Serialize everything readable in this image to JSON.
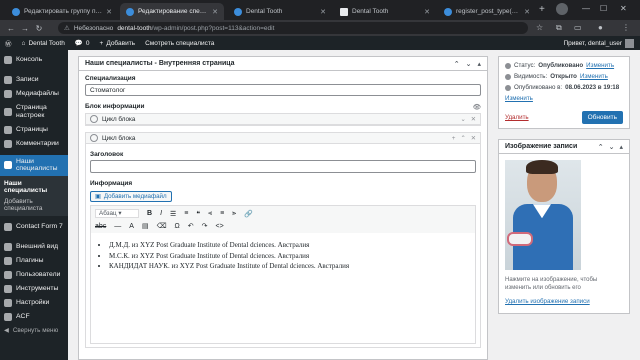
{
  "browser": {
    "tabs": [
      {
        "title": "Редактировать группу полей \"Н",
        "icon": "wordpress-icon"
      },
      {
        "title": "Редактирование специалиста",
        "icon": "wordpress-icon",
        "active": true
      },
      {
        "title": "Dental Tooth",
        "icon": "wordpress-icon"
      },
      {
        "title": "Dental Tooth",
        "icon": "document-icon"
      },
      {
        "title": "register_post_type() – Создает и",
        "icon": "wordpress-icon"
      }
    ],
    "new_tab": "+",
    "address": {
      "warning": "⚠",
      "security_label": "Небезопасно",
      "host": "dental-tooth",
      "path": "/wp-admin/post.php?post=113&action=edit"
    }
  },
  "adminbar": {
    "site": "Dental Tooth",
    "comments_count": "0",
    "add_new": "Добавить",
    "view": "Смотреть специалиста",
    "greeting": "Привет, dental_user"
  },
  "sidebar": {
    "items": [
      {
        "label": "Консоль"
      },
      {
        "label": "Записи"
      },
      {
        "label": "Медиафайлы"
      },
      {
        "label": "Страница настроек"
      },
      {
        "label": "Страницы"
      },
      {
        "label": "Комментарии"
      },
      {
        "label": "Наши специалисты",
        "current": true
      },
      {
        "label": "Contact Form 7"
      },
      {
        "label": "Внешний вид"
      },
      {
        "label": "Плагины"
      },
      {
        "label": "Пользователи"
      },
      {
        "label": "Инструменты"
      },
      {
        "label": "Настройки"
      },
      {
        "label": "ACF"
      }
    ],
    "submenu": [
      "Наши специалисты",
      "Добавить специалиста"
    ],
    "collapse": "Свернуть меню"
  },
  "acf_box": {
    "title": "Наши специалисты - Внутренняя страница",
    "specialization_label": "Специализация",
    "specialization_value": "Стоматолог",
    "info_block_label": "Блок информации",
    "layout1_title": "Цикл блока",
    "layout2_title": "Цикл блока",
    "heading_label": "Заголовок",
    "heading_value": "",
    "info_label": "Информация",
    "add_media": "Добавить медиафайл",
    "format_select": "Абзац",
    "content_items": [
      "Д.М.Д. из XYZ Post Graduate Institute of Dental dciences. Австралия",
      "М.С.К. из XYZ Post Graduate Institute of Dental dciences. Австралия",
      "КАНДИДАТ НАУК. из XYZ Post Graduate Institute of Dental dciences. Австралия"
    ]
  },
  "publish": {
    "status_label": "Статус:",
    "status_value": "Опубликовано",
    "status_edit": "Изменить",
    "visibility_label": "Видимость:",
    "visibility_value": "Открыто",
    "visibility_edit": "Изменить",
    "published_label": "Опубликовано в:",
    "published_value": "08.06.2023 в 19:18",
    "published_edit": "Изменить",
    "trash": "Удалить",
    "update": "Обновить"
  },
  "thumbnail": {
    "title": "Изображение записи",
    "note": "Нажмите на изображение, чтобы изменить или обновить его",
    "remove": "Удалить изображение записи"
  }
}
